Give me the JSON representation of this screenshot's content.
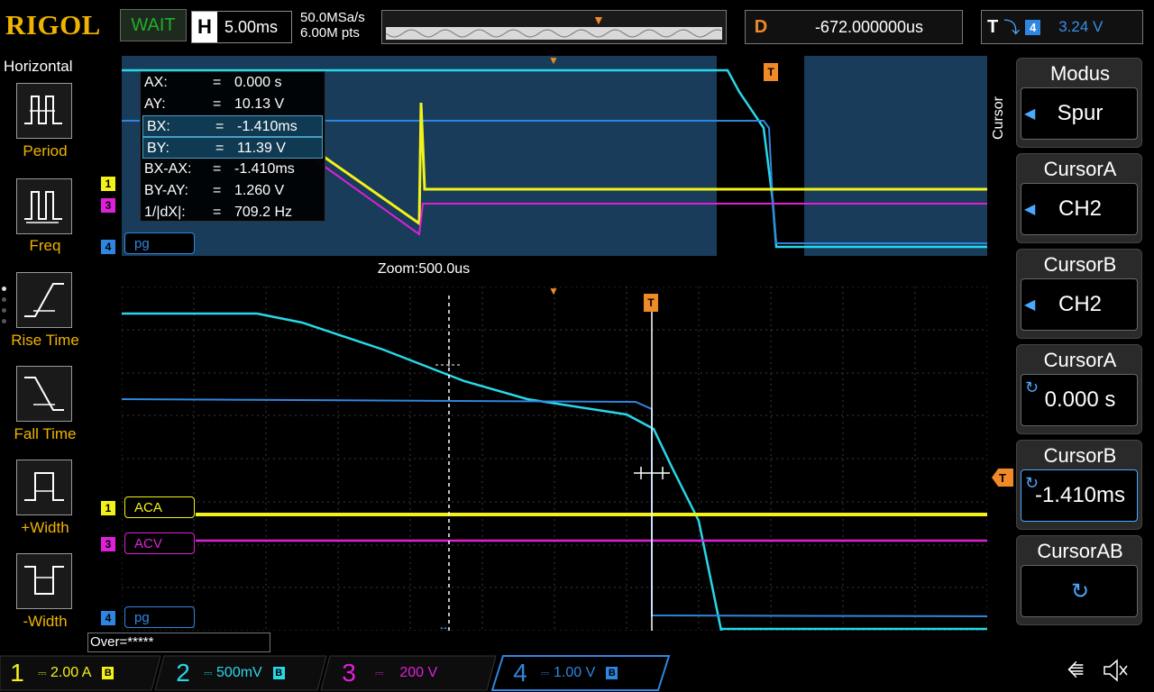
{
  "header": {
    "brand": "RIGOL",
    "status": "WAIT",
    "horizontal": {
      "label": "H",
      "value": "5.00ms"
    },
    "sample_rate": "50.0MSa/s",
    "memory_depth": "6.00M pts",
    "delay": {
      "label": "D",
      "value": "-672.000000us"
    },
    "trigger": {
      "label": "T",
      "source": "4",
      "level": "3.24 V"
    }
  },
  "left_menu": {
    "title": "Horizontal",
    "items": [
      {
        "label": "Period",
        "icon": "period-icon"
      },
      {
        "label": "Freq",
        "icon": "freq-icon"
      },
      {
        "label": "Rise Time",
        "icon": "rise-time-icon"
      },
      {
        "label": "Fall Time",
        "icon": "fall-time-icon"
      },
      {
        "label": "+Width",
        "icon": "pos-width-icon"
      },
      {
        "label": "-Width",
        "icon": "neg-width-icon"
      }
    ]
  },
  "cursor_info": {
    "rows": [
      {
        "key": "AX:",
        "eq": "=",
        "value": "0.000 s"
      },
      {
        "key": "AY:",
        "eq": "=",
        "value": "10.13 V"
      },
      {
        "key": "BX:",
        "eq": "=",
        "value": "-1.410ms"
      },
      {
        "key": "BY:",
        "eq": "=",
        "value": "11.39 V"
      },
      {
        "key": "BX-AX:",
        "eq": "=",
        "value": "-1.410ms"
      },
      {
        "key": "BY-AY:",
        "eq": "=",
        "value": "1.260 V"
      },
      {
        "key": "1/|dX|:",
        "eq": "=",
        "value": "709.2 Hz"
      }
    ]
  },
  "zoom": {
    "label": "Zoom:500.0us"
  },
  "channels_zoom": {
    "ch4_tag": "pg",
    "ch1_num": "1",
    "ch3_num": "3",
    "ch4_num": "4"
  },
  "channels_main": {
    "ch1": {
      "num": "1",
      "tag": "ACA"
    },
    "ch3": {
      "num": "3",
      "tag": "ACV"
    },
    "ch4": {
      "num": "4",
      "tag": "pg"
    }
  },
  "right_menu": {
    "side_label": "Cursor",
    "keys": [
      {
        "title": "Modus",
        "value": "Spur"
      },
      {
        "title": "CursorA",
        "value": "CH2"
      },
      {
        "title": "CursorB",
        "value": "CH2"
      },
      {
        "title": "CursorA",
        "value": "0.000 s"
      },
      {
        "title": "CursorB",
        "value": "-1.410ms"
      },
      {
        "title": "CursorAB",
        "value": ""
      }
    ]
  },
  "trigger_marker": "T",
  "over": "Over=*****",
  "bottom": {
    "ch1": {
      "num": "1",
      "value": "2.00 A",
      "bw": "B"
    },
    "ch2": {
      "num": "2",
      "value": "500mV",
      "bw": "B"
    },
    "ch3": {
      "num": "3",
      "value": "200 V"
    },
    "ch4": {
      "num": "4",
      "value": "1.00 V",
      "bw": "B"
    }
  },
  "colors": {
    "ch1": "#f2f21a",
    "ch2": "#28d8e8",
    "ch3": "#e020d8",
    "ch4": "#2f86e0",
    "trigger": "#f08a28",
    "brand": "#f0b400"
  }
}
